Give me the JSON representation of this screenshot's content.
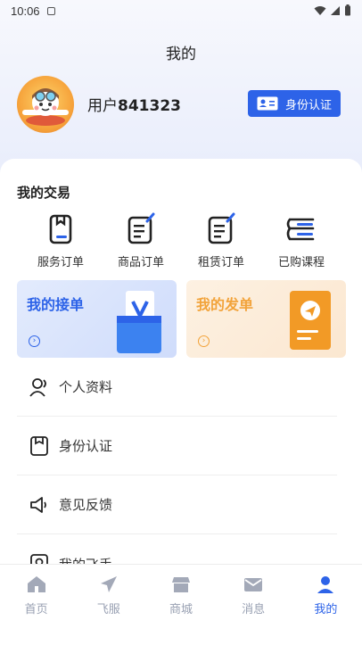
{
  "status_bar": {
    "time": "10:06"
  },
  "header": {
    "title": "我的"
  },
  "profile": {
    "user_prefix": "用户",
    "user_id": "841323",
    "auth_button": "身份认证"
  },
  "transactions": {
    "title": "我的交易",
    "items": [
      {
        "label": "服务订单",
        "icon": "service-order-icon"
      },
      {
        "label": "商品订单",
        "icon": "product-order-icon"
      },
      {
        "label": "租赁订单",
        "icon": "lease-order-icon"
      },
      {
        "label": "已购课程",
        "icon": "course-icon"
      }
    ]
  },
  "banners": {
    "receive": {
      "title": "我的接单",
      "color": "#2d63e8"
    },
    "publish": {
      "title": "我的发单",
      "color": "#f2a33a"
    }
  },
  "menu": [
    {
      "label": "个人资料",
      "icon": "user-icon"
    },
    {
      "label": "身份认证",
      "icon": "id-badge-icon"
    },
    {
      "label": "意见反馈",
      "icon": "megaphone-icon"
    },
    {
      "label": "我的飞手",
      "icon": "pilot-icon"
    }
  ],
  "bottom_nav": [
    {
      "label": "首页",
      "icon": "home-icon",
      "active": false
    },
    {
      "label": "飞服",
      "icon": "plane-icon",
      "active": false
    },
    {
      "label": "商城",
      "icon": "store-icon",
      "active": false
    },
    {
      "label": "消息",
      "icon": "mail-icon",
      "active": false
    },
    {
      "label": "我的",
      "icon": "person-icon",
      "active": true
    }
  ]
}
